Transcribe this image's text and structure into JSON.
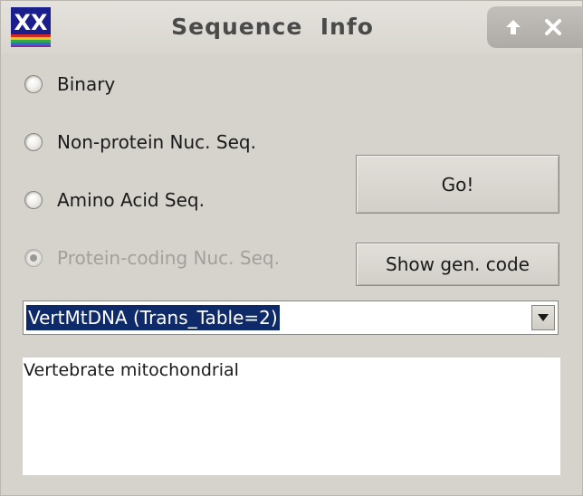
{
  "window": {
    "title": "Sequence  Info",
    "icon": "xx-app-icon"
  },
  "title_controls": {
    "up_icon": "arrow-up-icon",
    "close_icon": "close-icon"
  },
  "radios": [
    {
      "label": "Binary",
      "checked": false,
      "enabled": true
    },
    {
      "label": "Non-protein Nuc. Seq.",
      "checked": false,
      "enabled": true
    },
    {
      "label": "Amino Acid Seq.",
      "checked": false,
      "enabled": true
    },
    {
      "label": "Protein-coding Nuc. Seq.",
      "checked": true,
      "enabled": false
    }
  ],
  "buttons": {
    "go_label": "Go!",
    "show_code_label": "Show gen. code"
  },
  "genetic_code_select": {
    "value": "VertMtDNA (Trans_Table=2)"
  },
  "description": {
    "text": "Vertebrate mitochondrial"
  },
  "colors": {
    "selection_bg": "#0f2a68",
    "disabled_text": "#a3a09b",
    "window_bg": "#d6d3cd"
  }
}
